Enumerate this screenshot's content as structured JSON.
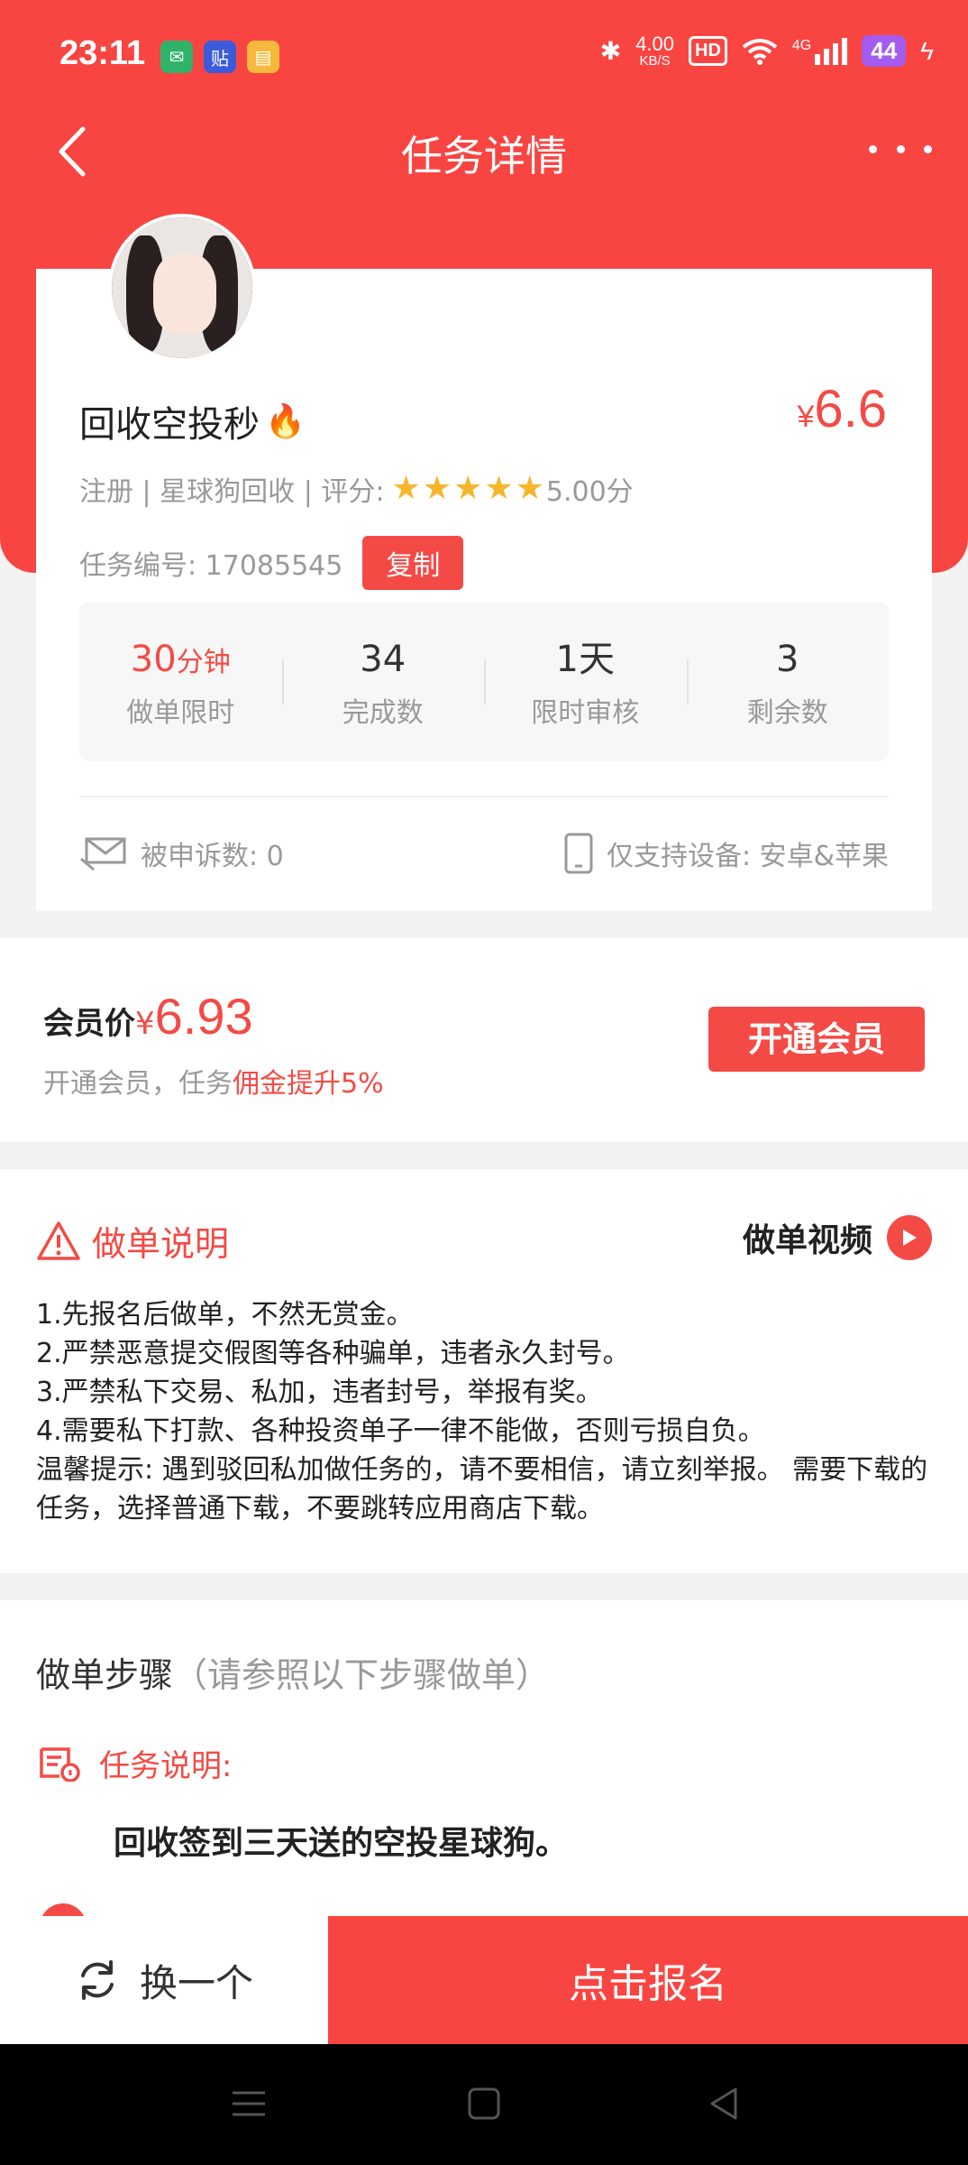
{
  "status_bar": {
    "time": "23:11",
    "net_speed": "4.00",
    "net_unit": "KB/S",
    "hd": "HD",
    "signal": "4G",
    "battery": "44"
  },
  "nav": {
    "title": "任务详情"
  },
  "task": {
    "title": "回收空投秒",
    "price_symbol": "¥",
    "price": "6.6",
    "meta": "注册 | 星球狗回收 | 评分:",
    "rating": 5,
    "rating_text": "5.00分",
    "task_no_label": "任务编号: 17085545",
    "copy_label": "复制"
  },
  "stats": [
    {
      "value": "30",
      "unit": "分钟",
      "label": "做单限时"
    },
    {
      "value": "34",
      "unit": "",
      "label": "完成数"
    },
    {
      "value": "1天",
      "unit": "",
      "label": "限时审核"
    },
    {
      "value": "3",
      "unit": "",
      "label": "剩余数"
    }
  ],
  "complaints": "被申诉数: 0",
  "devices": "仅支持设备: 安卓&苹果",
  "member": {
    "label": "会员价",
    "symbol": "¥",
    "price": "6.93",
    "sub_prefix": "开通会员，任务",
    "sub_highlight": "佣金提升5%",
    "button": "开通会员"
  },
  "instructions": {
    "title": "做单说明",
    "video_label": "做单视频",
    "lines": [
      "1.先报名后做单，不然无赏金。",
      "2.严禁恶意提交假图等各种骗单，违者永久封号。",
      "3.严禁私下交易、私加，违者封号，举报有奖。",
      "4.需要私下打款、各种投资单子一律不能做，否则亏损自负。",
      "温馨提示: 遇到驳回私加做任务的，请不要相信，请立刻举报。 需要下载的任务，选择普通下载，不要跳转应用商店下载。"
    ]
  },
  "steps": {
    "title": "做单步骤",
    "subtitle": "（请参照以下步骤做单）",
    "step1_label": "任务说明:",
    "step1_body": "回收签到三天送的空投星球狗。"
  },
  "bottom": {
    "swap": "换一个",
    "signup": "点击报名"
  },
  "colors": {
    "brand": "#f94542",
    "accent": "#f44a45",
    "star": "#f7b52c"
  }
}
